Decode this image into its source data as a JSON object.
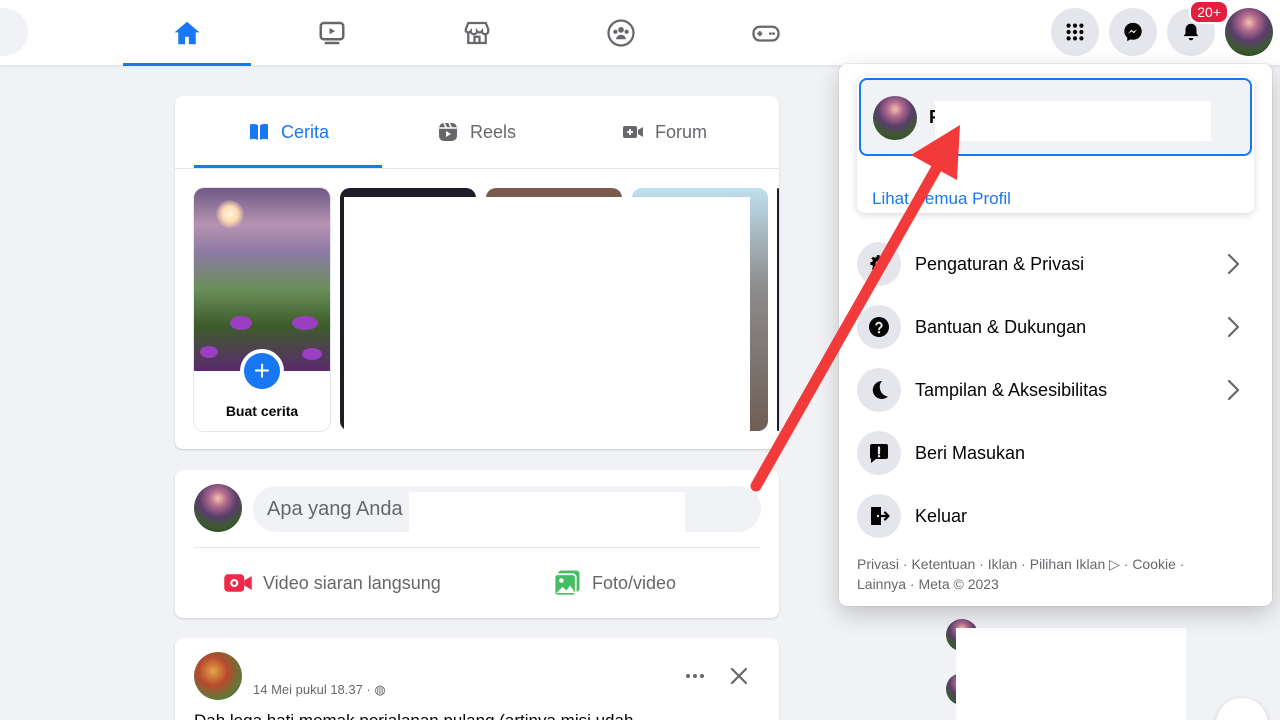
{
  "nav": {
    "items": [
      {
        "name": "home",
        "active": true
      },
      {
        "name": "watch",
        "active": false
      },
      {
        "name": "marketplace",
        "active": false
      },
      {
        "name": "groups",
        "active": false
      },
      {
        "name": "gaming",
        "active": false
      }
    ],
    "notification_count": "20+"
  },
  "stories": {
    "tabs": [
      {
        "label": "Cerita",
        "active": true
      },
      {
        "label": "Reels",
        "active": false
      },
      {
        "label": "Forum",
        "active": false
      }
    ],
    "create_label": "Buat cerita"
  },
  "composer": {
    "placeholder": "Apa yang Anda",
    "actions": [
      "Video siaran langsung",
      "Foto/video"
    ]
  },
  "post": {
    "time": "14 Mei pukul 18.37 ·",
    "text": "Dah lega hati memak perjalanan pulang (artinya misi udah"
  },
  "account_menu": {
    "profile_name_initial": "F",
    "see_all_profiles": "Lihat Semua Profil",
    "items": [
      {
        "label": "Pengaturan & Privasi",
        "icon": "gear-icon",
        "has_chevron": true
      },
      {
        "label": "Bantuan & Dukungan",
        "icon": "help-icon",
        "has_chevron": true
      },
      {
        "label": "Tampilan & Aksesibilitas",
        "icon": "moon-icon",
        "has_chevron": true
      },
      {
        "label": "Beri Masukan",
        "icon": "feedback-icon",
        "has_chevron": false
      },
      {
        "label": "Keluar",
        "icon": "logout-icon",
        "has_chevron": false
      }
    ],
    "footer_line1": "Privasi · Ketentuan · Iklan · Pilihan Iklan ▷ · Cookie ·",
    "footer_line2": "Lainnya · Meta © 2023"
  },
  "colors": {
    "accent": "#1877f2",
    "badge": "#e41e3f",
    "annotation_arrow": "#f23a3a"
  }
}
